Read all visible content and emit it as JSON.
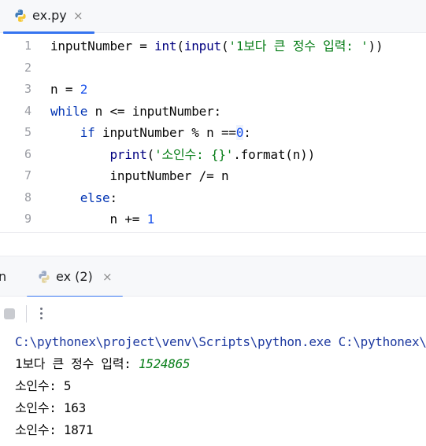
{
  "editor": {
    "tab": {
      "filename": "ex.py",
      "close_glyph": "×",
      "icon": "python-file-icon"
    },
    "lines": [
      {
        "number": "1",
        "tokens": [
          {
            "t": "inputNumber = ",
            "c": ""
          },
          {
            "t": "int",
            "c": "bi"
          },
          {
            "t": "(",
            "c": ""
          },
          {
            "t": "input",
            "c": "bi"
          },
          {
            "t": "(",
            "c": ""
          },
          {
            "t": "'1보다 큰 정수 입력: '",
            "c": "str"
          },
          {
            "t": "))",
            "c": ""
          }
        ]
      },
      {
        "number": "2",
        "tokens": []
      },
      {
        "number": "3",
        "tokens": [
          {
            "t": "n = ",
            "c": ""
          },
          {
            "t": "2",
            "c": "num"
          }
        ]
      },
      {
        "number": "4",
        "tokens": [
          {
            "t": "while",
            "c": "kw"
          },
          {
            "t": " n <= inputNumber:",
            "c": ""
          }
        ]
      },
      {
        "number": "5",
        "tokens": [
          {
            "t": "    ",
            "c": ""
          },
          {
            "t": "if",
            "c": "kw"
          },
          {
            "t": " inputNumber % n ==",
            "c": ""
          },
          {
            "t": "0",
            "c": "zero"
          },
          {
            "t": ":",
            "c": ""
          }
        ]
      },
      {
        "number": "6",
        "tokens": [
          {
            "t": "        ",
            "c": ""
          },
          {
            "t": "print",
            "c": "bi"
          },
          {
            "t": "(",
            "c": ""
          },
          {
            "t": "'소인수: {}'",
            "c": "str"
          },
          {
            "t": ".format(n))",
            "c": ""
          }
        ]
      },
      {
        "number": "7",
        "tokens": [
          {
            "t": "        inputNumber /= n",
            "c": ""
          }
        ]
      },
      {
        "number": "8",
        "tokens": [
          {
            "t": "    ",
            "c": ""
          },
          {
            "t": "else",
            "c": "kw"
          },
          {
            "t": ":",
            "c": ""
          }
        ]
      },
      {
        "number": "9",
        "tokens": [
          {
            "t": "        n += ",
            "c": ""
          },
          {
            "t": "1",
            "c": "num"
          }
        ]
      }
    ]
  },
  "run_panel": {
    "label_partial": "n",
    "tab": {
      "label": "ex (2)",
      "close_glyph": "×",
      "icon": "python-run-icon"
    },
    "toolbar": {
      "stop_icon": "stop-icon",
      "more_icon": "more-vertical-icon"
    },
    "console": {
      "command": "C:\\pythonex\\project\\venv\\Scripts\\python.exe C:\\pythonex\\project\\ex.py",
      "prompt": "1보다 큰 정수 입력: ",
      "user_input": "1524865",
      "outputs": [
        "소인수: 5",
        "소인수: 163",
        "소인수: 1871"
      ]
    }
  },
  "colors": {
    "accent": "#3574f0",
    "keyword": "#0033b3",
    "builtin": "#000080",
    "string": "#067d17",
    "number": "#1750eb",
    "line_number": "#9a9ca3",
    "toolbar_bg": "#f7f8fa"
  }
}
